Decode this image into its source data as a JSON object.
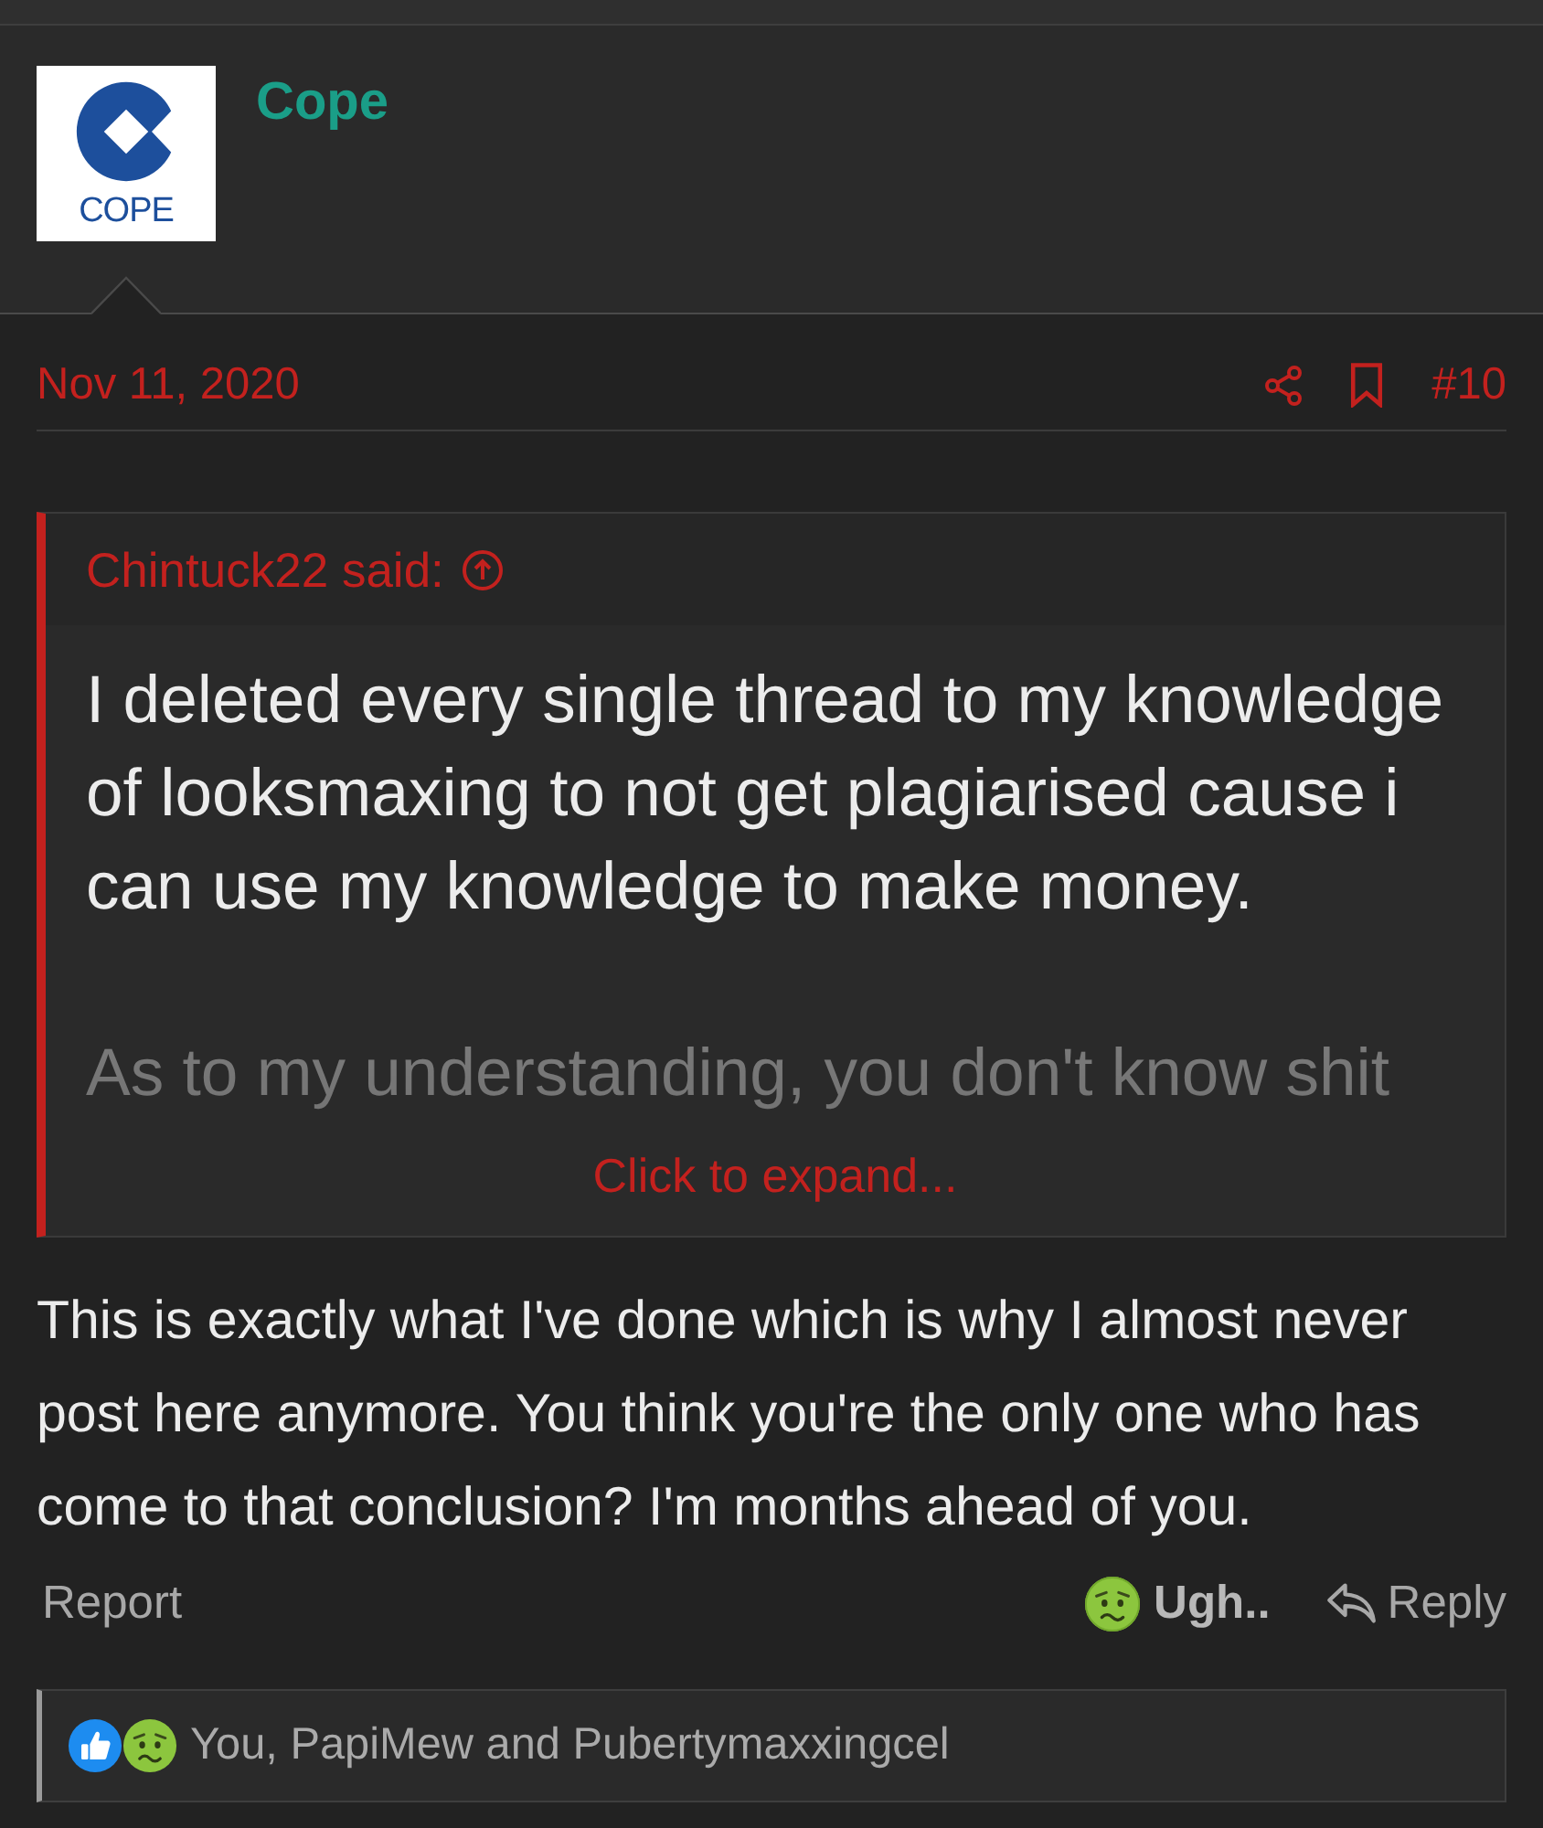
{
  "post": {
    "user": {
      "name": "Cope",
      "avatar_label": "COPE"
    },
    "date": "Nov 11, 2020",
    "post_number": "#10",
    "quote": {
      "attribution": "Chintuck22 said:",
      "paragraphs": [
        "I deleted every single thread to my knowledge of looksmaxing to not get plagiarised cause i can use my knowledge to make money.",
        "As to my understanding, you don't know shit"
      ],
      "expanded": false,
      "expand_label": "Click to expand..."
    },
    "message": "This is exactly what I've done which is why I almost never post here anymore. You think you're the only one who has come to that conclusion? I'm months ahead of you.",
    "actions": {
      "report": "Report",
      "reaction": {
        "label": "Ugh..",
        "reacted": true
      },
      "reply": "Reply"
    },
    "reactions_summary": "You, PapiMew and Pubertymaxxingcel"
  }
}
